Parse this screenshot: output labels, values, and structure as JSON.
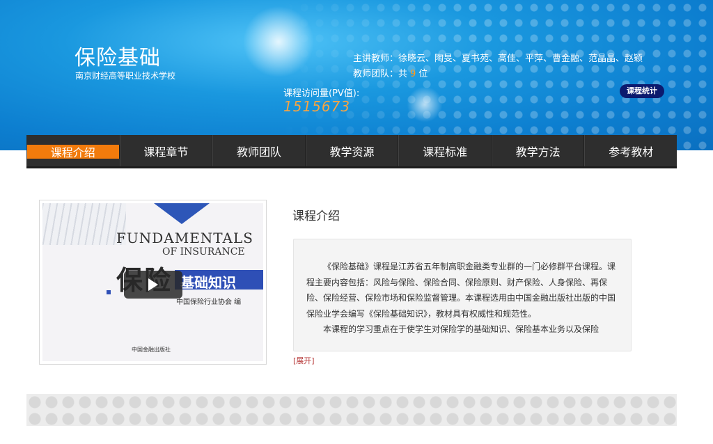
{
  "banner": {
    "course_title": "保险基础",
    "school_name": "南京财经高等职业技术学校",
    "teachers_label": "主讲教师：",
    "teachers": "徐晓云、陶旻、夏书苑、高佳、平萍、曹金融、范晶晶、赵颖",
    "team_prefix": "教师团队：共",
    "team_count": "9",
    "team_suffix": "位",
    "pv_label": "课程访问量(PV值):",
    "pv_value": "1515673",
    "stats_button": "课程统计"
  },
  "nav": {
    "items": [
      {
        "label": "课程介绍",
        "active": true
      },
      {
        "label": "课程章节"
      },
      {
        "label": "教师团队"
      },
      {
        "label": "教学资源"
      },
      {
        "label": "课程标准"
      },
      {
        "label": "教学方法"
      },
      {
        "label": "参考教材"
      }
    ]
  },
  "video": {
    "cover_title_en_1": "FUNDAMENTALS",
    "cover_title_en_2": "OF INSURANCE",
    "cover_title_cn_big": "保险",
    "cover_title_cn_sub": "基础知识",
    "cover_org": "中国保险行业协会  编",
    "cover_publisher": "中国金融出版社"
  },
  "intro": {
    "heading": "课程介绍",
    "paragraph_1": "《保险基础》课程是江苏省五年制高职金融类专业群的一门必修群平台课程。课程主要内容包括：风险与保险、保险合同、保险原则、财产保险、人身保险、再保险、保险经营、保险市场和保险监督管理。本课程选用由中国金融出版社出版的中国保险业学会编写《保险基础知识》，教材具有权威性和规范性。",
    "paragraph_2": "本课程的学习重点在于使学生对保险学的基础知识、保险基本业务以及保险",
    "expand": "[展开]"
  },
  "colors": {
    "nav_active": "#f27b0c",
    "nav_bg": "#2e2e2e",
    "pv_value": "#f6a443",
    "stats_button_bg": "#0c1a6e",
    "expand_link": "#b73a3a"
  }
}
